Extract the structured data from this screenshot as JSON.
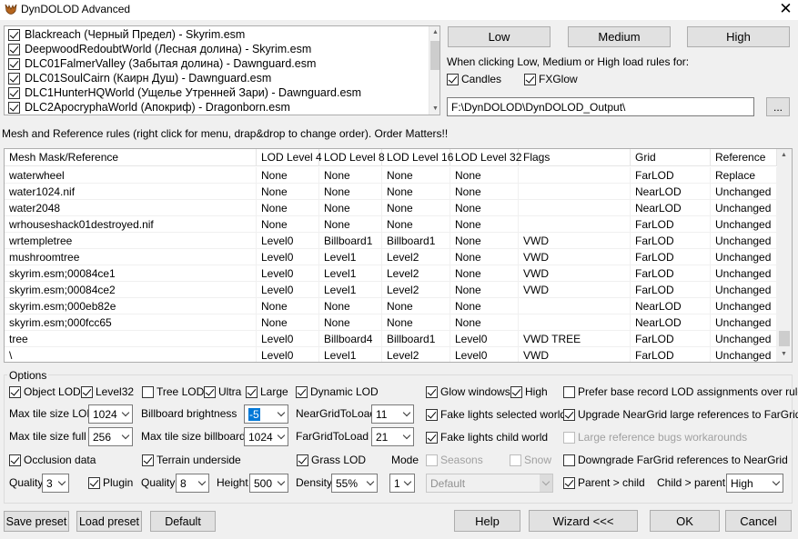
{
  "window": {
    "title": "DynDOLOD Advanced",
    "close_glyph": "✕"
  },
  "worldspaces": [
    {
      "label": "Blackreach (Черный Предел) - Skyrim.esm",
      "checked": true
    },
    {
      "label": "DeepwoodRedoubtWorld (Лесная долина) - Skyrim.esm",
      "checked": true
    },
    {
      "label": "DLC01FalmerValley (Забытая долина) - Dawnguard.esm",
      "checked": true
    },
    {
      "label": "DLC01SoulCairn (Каирн Душ) - Dawnguard.esm",
      "checked": true
    },
    {
      "label": "DLC1HunterHQWorld (Ущелье Утренней Зари) - Dawnguard.esm",
      "checked": true
    },
    {
      "label": "DLC2ApocryphaWorld (Апокриф) - Dragonborn.esm",
      "checked": true
    }
  ],
  "presets": {
    "low": "Low",
    "medium": "Medium",
    "high": "High"
  },
  "load_rules_text": "When clicking Low, Medium or High load rules for:",
  "candles": {
    "label": "Candles",
    "checked": true
  },
  "fxglow": {
    "label": "FXGlow",
    "checked": true
  },
  "output_path": "F:\\DynDOLOD\\DynDOLOD_Output\\",
  "browse_label": "...",
  "rules_caption": "Mesh and Reference rules (right click for menu, drap&drop to change order). Order Matters!!",
  "table": {
    "columns": [
      "Mesh Mask/Reference",
      "LOD Level 4",
      "LOD Level 8",
      "LOD Level 16",
      "LOD Level 32",
      "Flags",
      "Grid",
      "Reference"
    ],
    "rows": [
      [
        "waterwheel",
        "None",
        "None",
        "None",
        "None",
        "",
        "FarLOD",
        "Replace"
      ],
      [
        "water1024.nif",
        "None",
        "None",
        "None",
        "None",
        "",
        "NearLOD",
        "Unchanged"
      ],
      [
        "water2048",
        "None",
        "None",
        "None",
        "None",
        "",
        "NearLOD",
        "Unchanged"
      ],
      [
        "wrhouseshack01destroyed.nif",
        "None",
        "None",
        "None",
        "None",
        "",
        "FarLOD",
        "Unchanged"
      ],
      [
        "wrtempletree",
        "Level0",
        "Billboard1",
        "Billboard1",
        "None",
        "VWD",
        "FarLOD",
        "Unchanged"
      ],
      [
        "mushroomtree",
        "Level0",
        "Level1",
        "Level2",
        "None",
        "VWD",
        "FarLOD",
        "Unchanged"
      ],
      [
        "skyrim.esm;00084ce1",
        "Level0",
        "Level1",
        "Level2",
        "None",
        "VWD",
        "FarLOD",
        "Unchanged"
      ],
      [
        "skyrim.esm;00084ce2",
        "Level0",
        "Level1",
        "Level2",
        "None",
        "VWD",
        "FarLOD",
        "Unchanged"
      ],
      [
        "skyrim.esm;000eb82e",
        "None",
        "None",
        "None",
        "None",
        "",
        "NearLOD",
        "Unchanged"
      ],
      [
        "skyrim.esm;000fcc65",
        "None",
        "None",
        "None",
        "None",
        "",
        "NearLOD",
        "Unchanged"
      ],
      [
        "tree",
        "Level0",
        "Billboard4",
        "Billboard1",
        "Level0",
        "VWD TREE",
        "FarLOD",
        "Unchanged"
      ],
      [
        "\\",
        "Level0",
        "Level1",
        "Level2",
        "Level0",
        "VWD",
        "FarLOD",
        "Unchanged"
      ]
    ]
  },
  "options": {
    "legend": "Options",
    "object_lod": {
      "label": "Object LOD",
      "checked": true
    },
    "level32": {
      "label": "Level32",
      "checked": true
    },
    "tree_lod": {
      "label": "Tree LOD",
      "checked": false
    },
    "ultra": {
      "label": "Ultra",
      "checked": true
    },
    "large": {
      "label": "Large",
      "checked": true
    },
    "dynamic_lod": {
      "label": "Dynamic LOD",
      "checked": true
    },
    "glow_windows": {
      "label": "Glow windows",
      "checked": true
    },
    "high": {
      "label": "High",
      "checked": true
    },
    "prefer_base": {
      "label": "Prefer base record LOD assignments over rules",
      "checked": false
    },
    "max_tile_lod": {
      "label": "Max tile size LOD",
      "value": "1024"
    },
    "billboard_brightness": {
      "label": "Billboard brightness",
      "value": "-5"
    },
    "near_grid": {
      "label": "NearGridToLoad",
      "value": "11"
    },
    "fake_lights_selected": {
      "label": "Fake lights selected world",
      "checked": true
    },
    "upgrade_neargrid": {
      "label": "Upgrade NearGrid large references to FarGrid",
      "checked": true
    },
    "max_tile_full": {
      "label": "Max tile size full",
      "value": "256"
    },
    "max_tile_billboard": {
      "label": "Max tile size billboard",
      "value": "1024"
    },
    "far_grid": {
      "label": "FarGridToLoad",
      "value": "21"
    },
    "fake_lights_child": {
      "label": "Fake lights child world",
      "checked": true
    },
    "large_ref_bugs": {
      "label": "Large reference bugs workarounds",
      "checked": false
    },
    "occlusion": {
      "label": "Occlusion data",
      "checked": true
    },
    "terrain_underside": {
      "label": "Terrain underside",
      "checked": true
    },
    "grass_lod": {
      "label": "Grass LOD",
      "checked": true
    },
    "mode_label": "Mode",
    "seasons": {
      "label": "Seasons",
      "checked": false
    },
    "snow": {
      "label": "Snow",
      "checked": false
    },
    "downgrade_fargrid": {
      "label": "Downgrade FarGrid references to NearGrid",
      "checked": false
    },
    "quality1": {
      "label": "Quality",
      "value": "3"
    },
    "plugin": {
      "label": "Plugin",
      "checked": true
    },
    "quality2": {
      "label": "Quality",
      "value": "8"
    },
    "height": {
      "label": "Height",
      "value": "500"
    },
    "density": {
      "label": "Density",
      "value": "55%"
    },
    "mode_value": "1",
    "default_combo": "Default",
    "parent_child": {
      "label": "Parent > child",
      "checked": true
    },
    "child_parent": {
      "label": "Child > parent",
      "value": "High"
    }
  },
  "bottom": {
    "save_preset": "Save preset",
    "load_preset": "Load preset",
    "default": "Default",
    "help": "Help",
    "wizard": "Wizard <<<",
    "ok": "OK",
    "cancel": "Cancel"
  },
  "colors": {
    "accent": "#0078d7",
    "icon": "#b5651d"
  }
}
